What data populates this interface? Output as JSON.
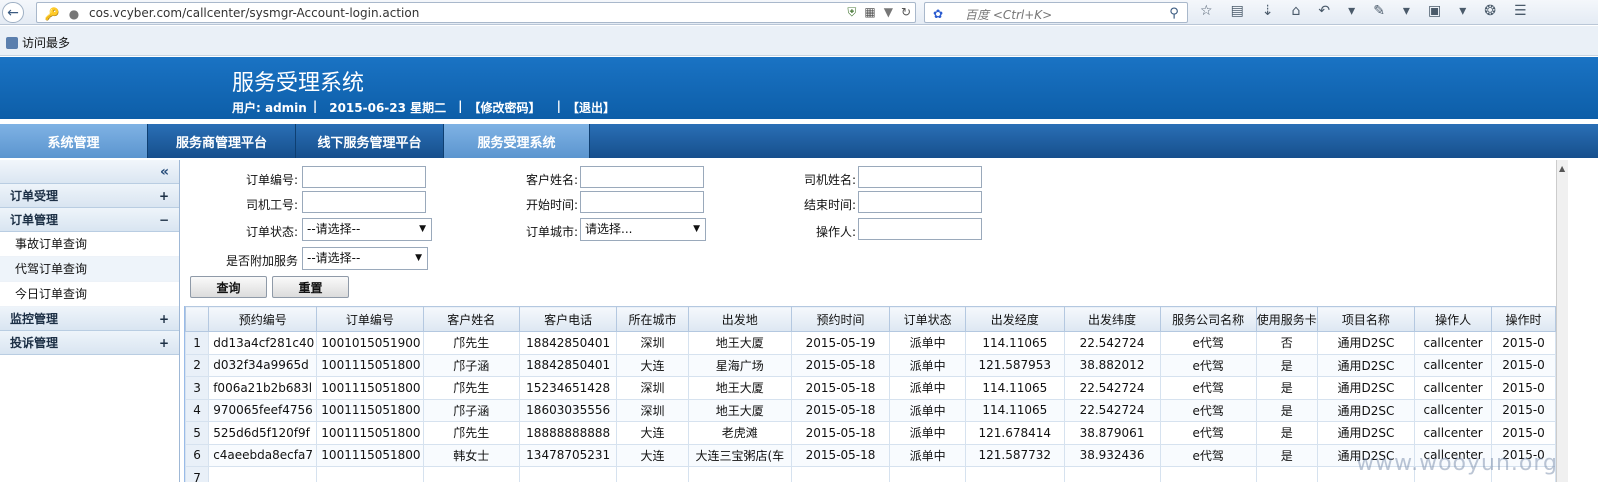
{
  "browser": {
    "url": "cos.vcyber.com/callcenter/sysmgr-Account-login.action",
    "search_placeholder": "百度 <Ctrl+K>",
    "bookmark": "访问最多"
  },
  "header": {
    "title": "服务受理系统",
    "user": "用户: admin",
    "sep1": "|",
    "date": "2015-06-23 星期二",
    "sep2": "|",
    "change_password": "【修改密码】",
    "sep3": "|",
    "logout": "【退出】"
  },
  "topnav": {
    "tabs": [
      {
        "label": "系统管理"
      },
      {
        "label": "服务商管理平台"
      },
      {
        "label": "线下服务管理平台"
      },
      {
        "label": "服务受理系统"
      }
    ]
  },
  "sidebar": {
    "collapse": "«",
    "groups": [
      {
        "label": "订单受理",
        "toggle": "+"
      },
      {
        "label": "订单管理",
        "toggle": "−"
      },
      {
        "label": "监控管理",
        "toggle": "+"
      },
      {
        "label": "投诉管理",
        "toggle": "+"
      }
    ],
    "items": [
      "事故订单查询",
      "代驾订单查询",
      "今日订单查询"
    ]
  },
  "form": {
    "order_no": "订单编号:",
    "customer_name": "客户姓名:",
    "driver_name": "司机姓名:",
    "driver_id": "司机工号:",
    "start_time": "开始时间:",
    "end_time": "结束时间:",
    "order_status": "订单状态:",
    "order_status_value": "--请选择--",
    "order_city": "订单城市:",
    "order_city_value": "请选择...",
    "operator": "操作人:",
    "extra_service": "是否附加服务",
    "extra_service_value": "--请选择--",
    "query": "查询",
    "reset": "重置"
  },
  "table": {
    "headers": [
      "",
      "预约编号",
      "订单编号",
      "客户姓名",
      "客户电话",
      "所在城市",
      "出发地",
      "预约时间",
      "订单状态",
      "出发经度",
      "出发纬度",
      "服务公司名称",
      "使用服务卡",
      "项目名称",
      "操作人",
      "操作时"
    ],
    "rows": [
      [
        "1",
        "dd13a4cf281c40",
        "1001015051900",
        "邝先生",
        "18842850401",
        "深圳",
        "地王大厦",
        "2015-05-19",
        "派单中",
        "114.11065",
        "22.542724",
        "e代驾",
        "否",
        "通用D2SC",
        "callcenter",
        "2015-0"
      ],
      [
        "2",
        "d032f34a9965d",
        "1001115051800",
        "邝子涵",
        "18842850401",
        "大连",
        "星海广场",
        "2015-05-18",
        "派单中",
        "121.587953",
        "38.882012",
        "e代驾",
        "是",
        "通用D2SC",
        "callcenter",
        "2015-0"
      ],
      [
        "3",
        "f006a21b2b683l",
        "1001115051800",
        "邝先生",
        "15234651428",
        "深圳",
        "地王大厦",
        "2015-05-18",
        "派单中",
        "114.11065",
        "22.542724",
        "e代驾",
        "是",
        "通用D2SC",
        "callcenter",
        "2015-0"
      ],
      [
        "4",
        "970065feef4756",
        "1001115051800",
        "邝子涵",
        "18603035556",
        "深圳",
        "地王大厦",
        "2015-05-18",
        "派单中",
        "114.11065",
        "22.542724",
        "e代驾",
        "是",
        "通用D2SC",
        "callcenter",
        "2015-0"
      ],
      [
        "5",
        "525d6d5f120f9f",
        "1001115051800",
        "邝先生",
        "18888888888",
        "大连",
        "老虎滩",
        "2015-05-18",
        "派单中",
        "121.678414",
        "38.879061",
        "e代驾",
        "是",
        "通用D2SC",
        "callcenter",
        "2015-0"
      ],
      [
        "6",
        "c4aeebda8ecfa7",
        "1001115051800",
        "韩女士",
        "13478705231",
        "大连",
        "大连三宝粥店(车",
        "2015-05-18",
        "派单中",
        "121.587732",
        "38.932436",
        "e代驾",
        "是",
        "通用D2SC",
        "callcenter",
        "2015-0"
      ],
      [
        "7",
        "",
        "",
        "",
        "",
        "",
        "",
        "",
        "",
        "",
        "",
        "",
        "",
        "",
        "",
        ""
      ]
    ]
  },
  "watermark": "www.wooyun.org"
}
